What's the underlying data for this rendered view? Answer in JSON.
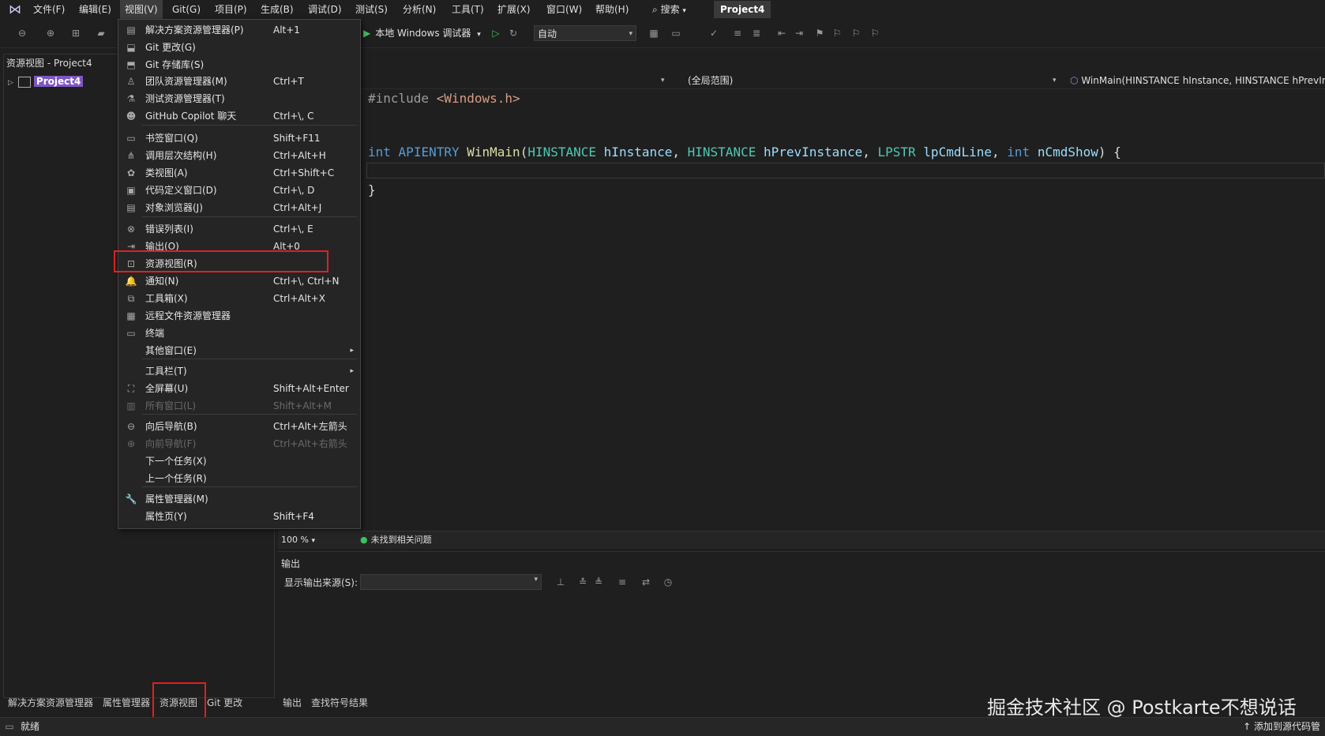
{
  "menubar": {
    "items": [
      "文件(F)",
      "编辑(E)",
      "视图(V)",
      "Git(G)",
      "项目(P)",
      "生成(B)",
      "调试(D)",
      "测试(S)",
      "分析(N)",
      "工具(T)",
      "扩展(X)",
      "窗口(W)",
      "帮助(H)"
    ],
    "search": "搜索",
    "project_title": "Project4"
  },
  "toolbar": {
    "debugger_label": "本地 Windows 调试器",
    "config_value": "自动"
  },
  "left_panel": {
    "title": "资源视图 - Project4",
    "tree_root": "Project4",
    "bottom_tabs": [
      "解决方案资源管理器",
      "属性管理器",
      "资源视图",
      "Git 更改"
    ]
  },
  "editor": {
    "scope": "(全局范围)",
    "function": "WinMain(HINSTANCE hInstance, HINSTANCE hPrevIns",
    "line1_directive": "#include",
    "line1_header": "<Windows.h>",
    "line2": {
      "kw1": "int",
      "kw2": "APIENTRY",
      "fn": "WinMain",
      "t1": "HINSTANCE",
      "p1": "hInstance",
      "t2": "HINSTANCE",
      "p2": "hPrevInstance",
      "t3": "LPSTR",
      "p3": "lpCmdLine",
      "kw3": "int",
      "p4": "nCmdShow"
    },
    "close_brace": "}",
    "zoom": "100 %",
    "issues": "未找到相关问题"
  },
  "output": {
    "title": "输出",
    "source_label": "显示输出来源(S):",
    "tabs": [
      "输出",
      "查找符号结果"
    ]
  },
  "status": {
    "text": "就绪",
    "right": "添加到源代码管"
  },
  "watermark": "掘金技术社区 @ Postkarte不想说话",
  "view_menu": {
    "items": [
      {
        "icon": "solution-explorer-icon",
        "glyph": "▤",
        "label": "解决方案资源管理器(P)",
        "shortcut": "Alt+1"
      },
      {
        "icon": "git-changes-icon",
        "glyph": "⬓",
        "label": "Git 更改(G)",
        "shortcut": ""
      },
      {
        "icon": "git-repository-icon",
        "glyph": "⬒",
        "label": "Git 存储库(S)",
        "shortcut": ""
      },
      {
        "icon": "team-explorer-icon",
        "glyph": "♙",
        "label": "团队资源管理器(M)",
        "shortcut": "Ctrl+T"
      },
      {
        "icon": "test-explorer-icon",
        "glyph": "⚗",
        "label": "测试资源管理器(T)",
        "shortcut": ""
      },
      {
        "icon": "copilot-icon",
        "glyph": "☻",
        "label": "GitHub Copilot 聊天",
        "shortcut": "Ctrl+\\, C"
      },
      {
        "icon": "bookmark-window-icon",
        "glyph": "▭",
        "label": "书签窗口(Q)",
        "shortcut": "Shift+F11"
      },
      {
        "icon": "call-hierarchy-icon",
        "glyph": "⋔",
        "label": "调用层次结构(H)",
        "shortcut": "Ctrl+Alt+H"
      },
      {
        "icon": "class-view-icon",
        "glyph": "✿",
        "label": "类视图(A)",
        "shortcut": "Ctrl+Shift+C"
      },
      {
        "icon": "code-definition-icon",
        "glyph": "▣",
        "label": "代码定义窗口(D)",
        "shortcut": "Ctrl+\\, D"
      },
      {
        "icon": "object-browser-icon",
        "glyph": "▤",
        "label": "对象浏览器(J)",
        "shortcut": "Ctrl+Alt+J"
      },
      {
        "icon": "error-list-icon",
        "glyph": "⊗",
        "label": "错误列表(I)",
        "shortcut": "Ctrl+\\, E"
      },
      {
        "icon": "output-icon",
        "glyph": "⇥",
        "label": "输出(O)",
        "shortcut": "Alt+0"
      },
      {
        "icon": "resource-view-icon",
        "glyph": "⊡",
        "label": "资源视图(R)",
        "shortcut": ""
      },
      {
        "icon": "bell-icon",
        "glyph": "🔔",
        "label": "通知(N)",
        "shortcut": "Ctrl+\\, Ctrl+N"
      },
      {
        "icon": "toolbox-icon",
        "glyph": "⧉",
        "label": "工具箱(X)",
        "shortcut": "Ctrl+Alt+X"
      },
      {
        "icon": "remote-file-icon",
        "glyph": "▦",
        "label": "远程文件资源管理器",
        "shortcut": ""
      },
      {
        "icon": "terminal-icon",
        "glyph": "▭",
        "label": "终端",
        "shortcut": ""
      },
      {
        "icon": "",
        "glyph": "",
        "label": "其他窗口(E)",
        "shortcut": "",
        "submenu": true
      },
      {
        "icon": "",
        "glyph": "",
        "label": "工具栏(T)",
        "shortcut": "",
        "submenu": true
      },
      {
        "icon": "fullscreen-icon",
        "glyph": "⛶",
        "label": "全屏幕(U)",
        "shortcut": "Shift+Alt+Enter"
      },
      {
        "icon": "all-windows-icon",
        "glyph": "▥",
        "label": "所有窗口(L)",
        "shortcut": "Shift+Alt+M",
        "disabled": true
      },
      {
        "icon": "navigate-back-icon",
        "glyph": "⊖",
        "label": "向后导航(B)",
        "shortcut": "Ctrl+Alt+左箭头"
      },
      {
        "icon": "navigate-forward-icon",
        "glyph": "⊕",
        "label": "向前导航(F)",
        "shortcut": "Ctrl+Alt+右箭头",
        "disabled": true
      },
      {
        "icon": "",
        "glyph": "",
        "label": "下一个任务(X)",
        "shortcut": ""
      },
      {
        "icon": "",
        "glyph": "",
        "label": "上一个任务(R)",
        "shortcut": ""
      },
      {
        "icon": "wrench-icon",
        "glyph": "🔧",
        "label": "属性管理器(M)",
        "shortcut": ""
      },
      {
        "icon": "",
        "glyph": "",
        "label": "属性页(Y)",
        "shortcut": "Shift+F4"
      }
    ]
  }
}
